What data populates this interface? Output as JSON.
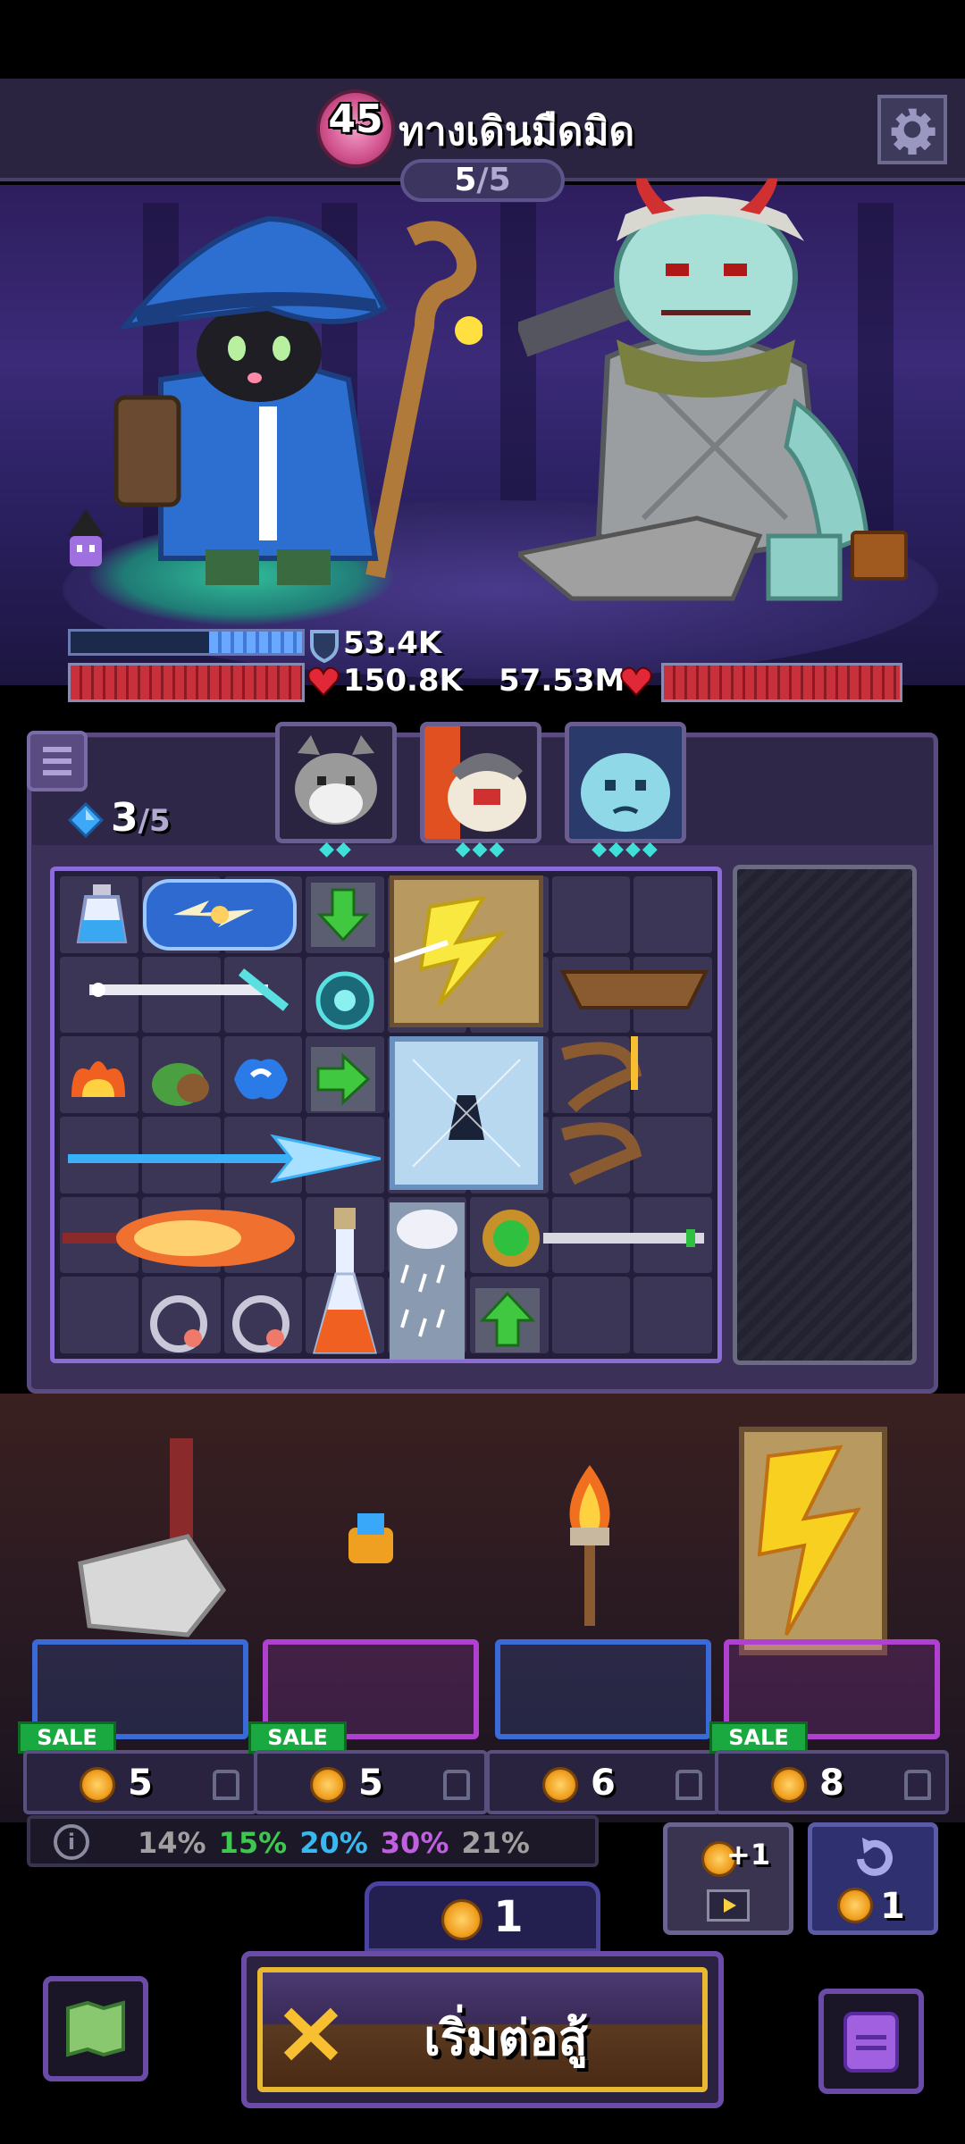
{
  "header": {
    "stage_number": "45",
    "stage_title": "ทางเดินมืดมิด",
    "wave_current": "5",
    "wave_total": "/5"
  },
  "player": {
    "shield": "53.4K",
    "hp": "150.8K",
    "shield_fill": 0.4,
    "hp_fill": 1.0
  },
  "enemy": {
    "hp": "57.53M",
    "hp_fill": 1.0
  },
  "inventory": {
    "gems": "3",
    "gems_total": "/5",
    "companions": [
      {
        "name": "grey-cat-companion",
        "stars": "◆◆"
      },
      {
        "name": "knight-cat-companion",
        "stars": "◆◆◆"
      },
      {
        "name": "ghost-cat-companion",
        "stars": "◆◆◆◆"
      }
    ]
  },
  "shop": {
    "items": [
      {
        "price": "5",
        "sale": "SALE",
        "plate_color": "#3a6ad8"
      },
      {
        "price": "5",
        "sale": "SALE",
        "plate_color": "#b040d0"
      },
      {
        "price": "6",
        "sale": "",
        "plate_color": "#3a6ad8"
      },
      {
        "price": "8",
        "sale": "SALE",
        "plate_color": "#b040d0"
      }
    ],
    "rarity": [
      {
        "pct": "14%",
        "color": "#a0a0a0"
      },
      {
        "pct": "15%",
        "color": "#3ec850"
      },
      {
        "pct": "20%",
        "color": "#38b8f0"
      },
      {
        "pct": "30%",
        "color": "#c060e0"
      },
      {
        "pct": "21%",
        "color": "#a0a0a0"
      }
    ],
    "upgrade_label": "+1",
    "reroll_cost": "1"
  },
  "gold": "1",
  "start_button": "เริ่มต่อสู้",
  "colors": {
    "accent_purple": "#6a4ca8",
    "gold_border": "#e8b830",
    "hp_red": "#c8303c",
    "shield_blue": "#69a8ff"
  }
}
